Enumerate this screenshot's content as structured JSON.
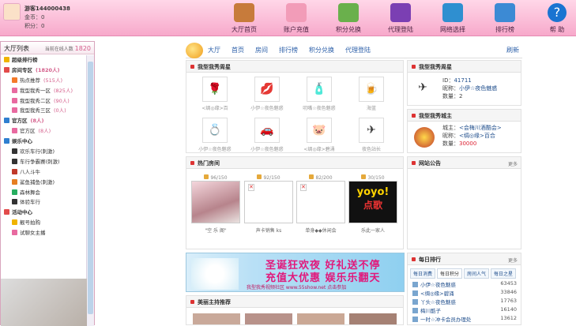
{
  "user": {
    "name": "游客144000438",
    "coin_label": "金币：",
    "coin": "0",
    "points_label": "积分：",
    "points": "0"
  },
  "nav": [
    {
      "label": "大厅首页",
      "icon": "house-icon",
      "color": "#c77b3b"
    },
    {
      "label": "账户充值",
      "icon": "piggy-bank-icon",
      "color": "#f29cb8"
    },
    {
      "label": "积分兑换",
      "icon": "calculator-icon",
      "color": "#6ab04c"
    },
    {
      "label": "代理登陆",
      "icon": "books-icon",
      "color": "#7b3fb3"
    },
    {
      "label": "网络选择",
      "icon": "globe-icon",
      "color": "#2f8fd0"
    },
    {
      "label": "排行榜",
      "icon": "notebook-icon",
      "color": "#3c8ad4"
    },
    {
      "label": "帮 助",
      "icon": "help-icon",
      "color": "#1a74d1"
    }
  ],
  "sidebar": {
    "title": "大厅列表",
    "online_label": "当前在线人数",
    "online_count": "1820",
    "items": [
      {
        "label": "超级排行榜",
        "count": "",
        "icon_color": "#f0b400",
        "bold": true,
        "indent": 0
      },
      {
        "label": "房间专区",
        "count": "(1820人)",
        "icon_color": "#e24b4b",
        "bold": true,
        "indent": 0
      },
      {
        "label": "热点推荐",
        "count": "(515人)",
        "icon_color": "#f47a2a",
        "bold": false,
        "indent": 1
      },
      {
        "label": "我型我秀一区",
        "count": "(825人)",
        "icon_color": "#e86aa0",
        "bold": false,
        "indent": 1
      },
      {
        "label": "我型我秀二区",
        "count": "(90人)",
        "icon_color": "#e86aa0",
        "bold": false,
        "indent": 1
      },
      {
        "label": "我型我秀三区",
        "count": "(0人)",
        "icon_color": "#e86aa0",
        "bold": false,
        "indent": 1
      },
      {
        "label": "官方区",
        "count": "(8人)",
        "icon_color": "#2f7fd0",
        "bold": true,
        "indent": 0
      },
      {
        "label": "官方区",
        "count": "(8人)",
        "icon_color": "#e86aa0",
        "bold": false,
        "indent": 1
      },
      {
        "label": "娱乐中心",
        "count": "",
        "icon_color": "#2f7fd0",
        "bold": true,
        "indent": 0
      },
      {
        "label": "欢乐车行(刺激)",
        "count": "",
        "icon_color": "#333",
        "bold": false,
        "indent": 1
      },
      {
        "label": "车行争霸赛(刺激)",
        "count": "",
        "icon_color": "#333",
        "bold": false,
        "indent": 1
      },
      {
        "label": "八人斗牛",
        "count": "",
        "icon_color": "#c0392b",
        "bold": false,
        "indent": 1
      },
      {
        "label": "鲨鱼捕鱼(刺激)",
        "count": "",
        "icon_color": "#e67e22",
        "bold": false,
        "indent": 1
      },
      {
        "label": "森林舞会",
        "count": "",
        "icon_color": "#27ae60",
        "bold": false,
        "indent": 1
      },
      {
        "label": "体验车行",
        "count": "",
        "icon_color": "#333",
        "bold": false,
        "indent": 1
      },
      {
        "label": "活动中心",
        "count": "",
        "icon_color": "#e24b4b",
        "bold": true,
        "indent": 0
      },
      {
        "label": "靓号拍购",
        "count": "",
        "icon_color": "#f0b400",
        "bold": false,
        "indent": 1
      },
      {
        "label": "试聊女主播",
        "count": "",
        "icon_color": "#e86aa0",
        "bold": false,
        "indent": 1
      }
    ]
  },
  "main": {
    "links": [
      "大厅",
      "首页",
      "房间",
      "排行榜",
      "积分兑换",
      "代理登陆"
    ],
    "refresh": "刷新"
  },
  "gifts_panel": {
    "title": "我型我秀周星",
    "gifts": [
      {
        "name": "玫瑰",
        "glyph": "🌹",
        "caption": "<绸◎缘>百"
      },
      {
        "name": "红唇",
        "glyph": "💋",
        "caption": "小伊☆夜色魅惑"
      },
      {
        "name": "香水",
        "glyph": "🧴",
        "caption": "叨嘴☆夜色魅惑"
      },
      {
        "name": "啤酒",
        "glyph": "🍺",
        "caption": "海蓝"
      },
      {
        "name": "钻戒",
        "glyph": "💍",
        "caption": "小伊☆夜色魅惑"
      },
      {
        "name": "跑车",
        "glyph": "🚗",
        "caption": "小伊☆夜色魅惑"
      },
      {
        "name": "猪头",
        "glyph": "🐷",
        "caption": "<绸◎缘>碧涌"
      },
      {
        "name": "飞机",
        "glyph": "✈",
        "caption": "夜色站长"
      }
    ]
  },
  "hot_rooms": {
    "title": "热门房间",
    "rooms": [
      {
        "count": "96/150",
        "name": "\"空 乐 阁\"",
        "style": "photo"
      },
      {
        "count": "92/150",
        "name": "声卡销售 ks",
        "style": "broken"
      },
      {
        "count": "82/200",
        "name": "单身◆◆休闲会",
        "style": "broken"
      },
      {
        "count": "30/150",
        "name": "乐此一家人",
        "style": "yoyo"
      }
    ],
    "yoyo_text": "yoyo!",
    "yoyo_sub": "点歌"
  },
  "weekly_star": {
    "title": "我型我秀周星",
    "id_label": "ID：",
    "id": "41711",
    "nick_label": "昵称：",
    "nick": "小伊☆夜色魅惑",
    "qty_label": "数量：",
    "qty": "2"
  },
  "city_king": {
    "title": "我型我秀城主",
    "king_label": "城主：",
    "king": "<会梅川酒酷会>",
    "nick_label": "昵称：",
    "nick": "<绸◎缘>百合",
    "qty_label": "数量：",
    "qty": "30000"
  },
  "notice": {
    "title": "网站公告",
    "more": "更多"
  },
  "banner": {
    "line1": "圣诞狂欢夜  好礼送不停",
    "line2": "充值大优惠  娱乐乐翻天",
    "line3": "我型我秀视频社区 www.55show.net 点击参加"
  },
  "beauty": {
    "title": "美丽主持推荐"
  },
  "daily_rank": {
    "title": "每日排行",
    "more": "更多",
    "tabs": [
      "每日消费",
      "每日积分",
      "房间人气",
      "每日之星"
    ],
    "active_tab": 1,
    "rows": [
      {
        "name": "小伊☆夜色魅惑",
        "value": "63453"
      },
      {
        "name": "<绸◎缘>碧涌",
        "value": "33846"
      },
      {
        "name": "丫头☆夜色魅惑",
        "value": "17763"
      },
      {
        "name": "梅川酷子",
        "value": "16140"
      },
      {
        "name": "一时☆冲卡会员办理处",
        "value": "13612"
      }
    ]
  }
}
